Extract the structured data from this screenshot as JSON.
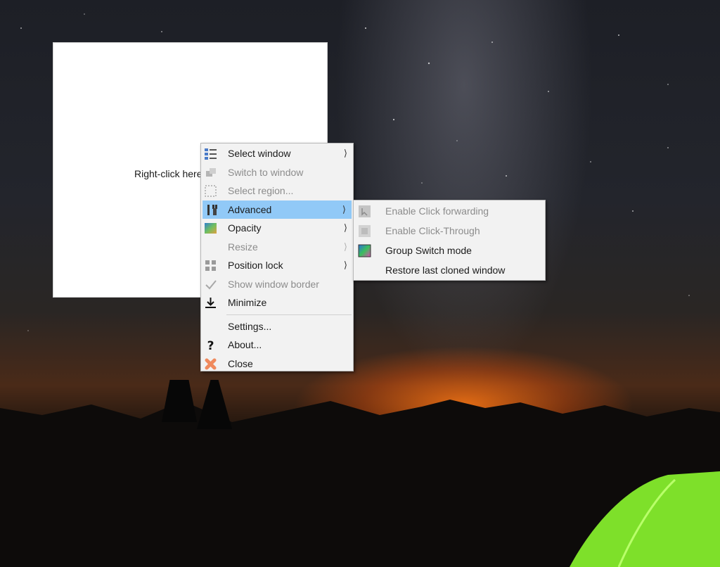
{
  "clone_window": {
    "hint": "Right-click here"
  },
  "context_menu": {
    "items": [
      {
        "label": "Select window",
        "icon": "window-list-icon",
        "enabled": true,
        "submenu": true
      },
      {
        "label": "Switch to window",
        "icon": "switch-window-icon",
        "enabled": false,
        "submenu": false
      },
      {
        "label": "Select region...",
        "icon": "region-select-icon",
        "enabled": false,
        "submenu": false
      },
      {
        "label": "Advanced",
        "icon": "tools-icon",
        "enabled": true,
        "submenu": true,
        "highlighted": true
      },
      {
        "label": "Opacity",
        "icon": "opacity-icon",
        "enabled": true,
        "submenu": true
      },
      {
        "label": "Resize",
        "icon": "",
        "enabled": false,
        "submenu": true
      },
      {
        "label": "Position lock",
        "icon": "position-lock-icon",
        "enabled": true,
        "submenu": true
      },
      {
        "label": "Show window border",
        "icon": "checkmark-icon",
        "enabled": false,
        "submenu": false
      },
      {
        "label": "Minimize",
        "icon": "minimize-icon",
        "enabled": true,
        "submenu": false
      },
      {
        "label": "Settings...",
        "icon": "",
        "enabled": true,
        "submenu": false
      },
      {
        "label": "About...",
        "icon": "question-icon",
        "enabled": true,
        "submenu": false
      },
      {
        "label": "Close",
        "icon": "close-icon",
        "enabled": true,
        "submenu": false
      }
    ],
    "arrow_glyph": "⟩"
  },
  "advanced_submenu": {
    "items": [
      {
        "label": "Enable Click forwarding",
        "icon": "click-forwarding-icon",
        "enabled": false
      },
      {
        "label": "Enable Click-Through",
        "icon": "click-through-icon",
        "enabled": false
      },
      {
        "label": "Group Switch mode",
        "icon": "group-switch-icon",
        "enabled": true
      },
      {
        "label": "Restore last cloned window",
        "icon": "",
        "enabled": true
      }
    ]
  },
  "colors": {
    "menu_background": "#f2f2f2",
    "highlight": "#91c9f7",
    "disabled_text": "#8c8c8c",
    "tent_green": "#7ee02a"
  }
}
